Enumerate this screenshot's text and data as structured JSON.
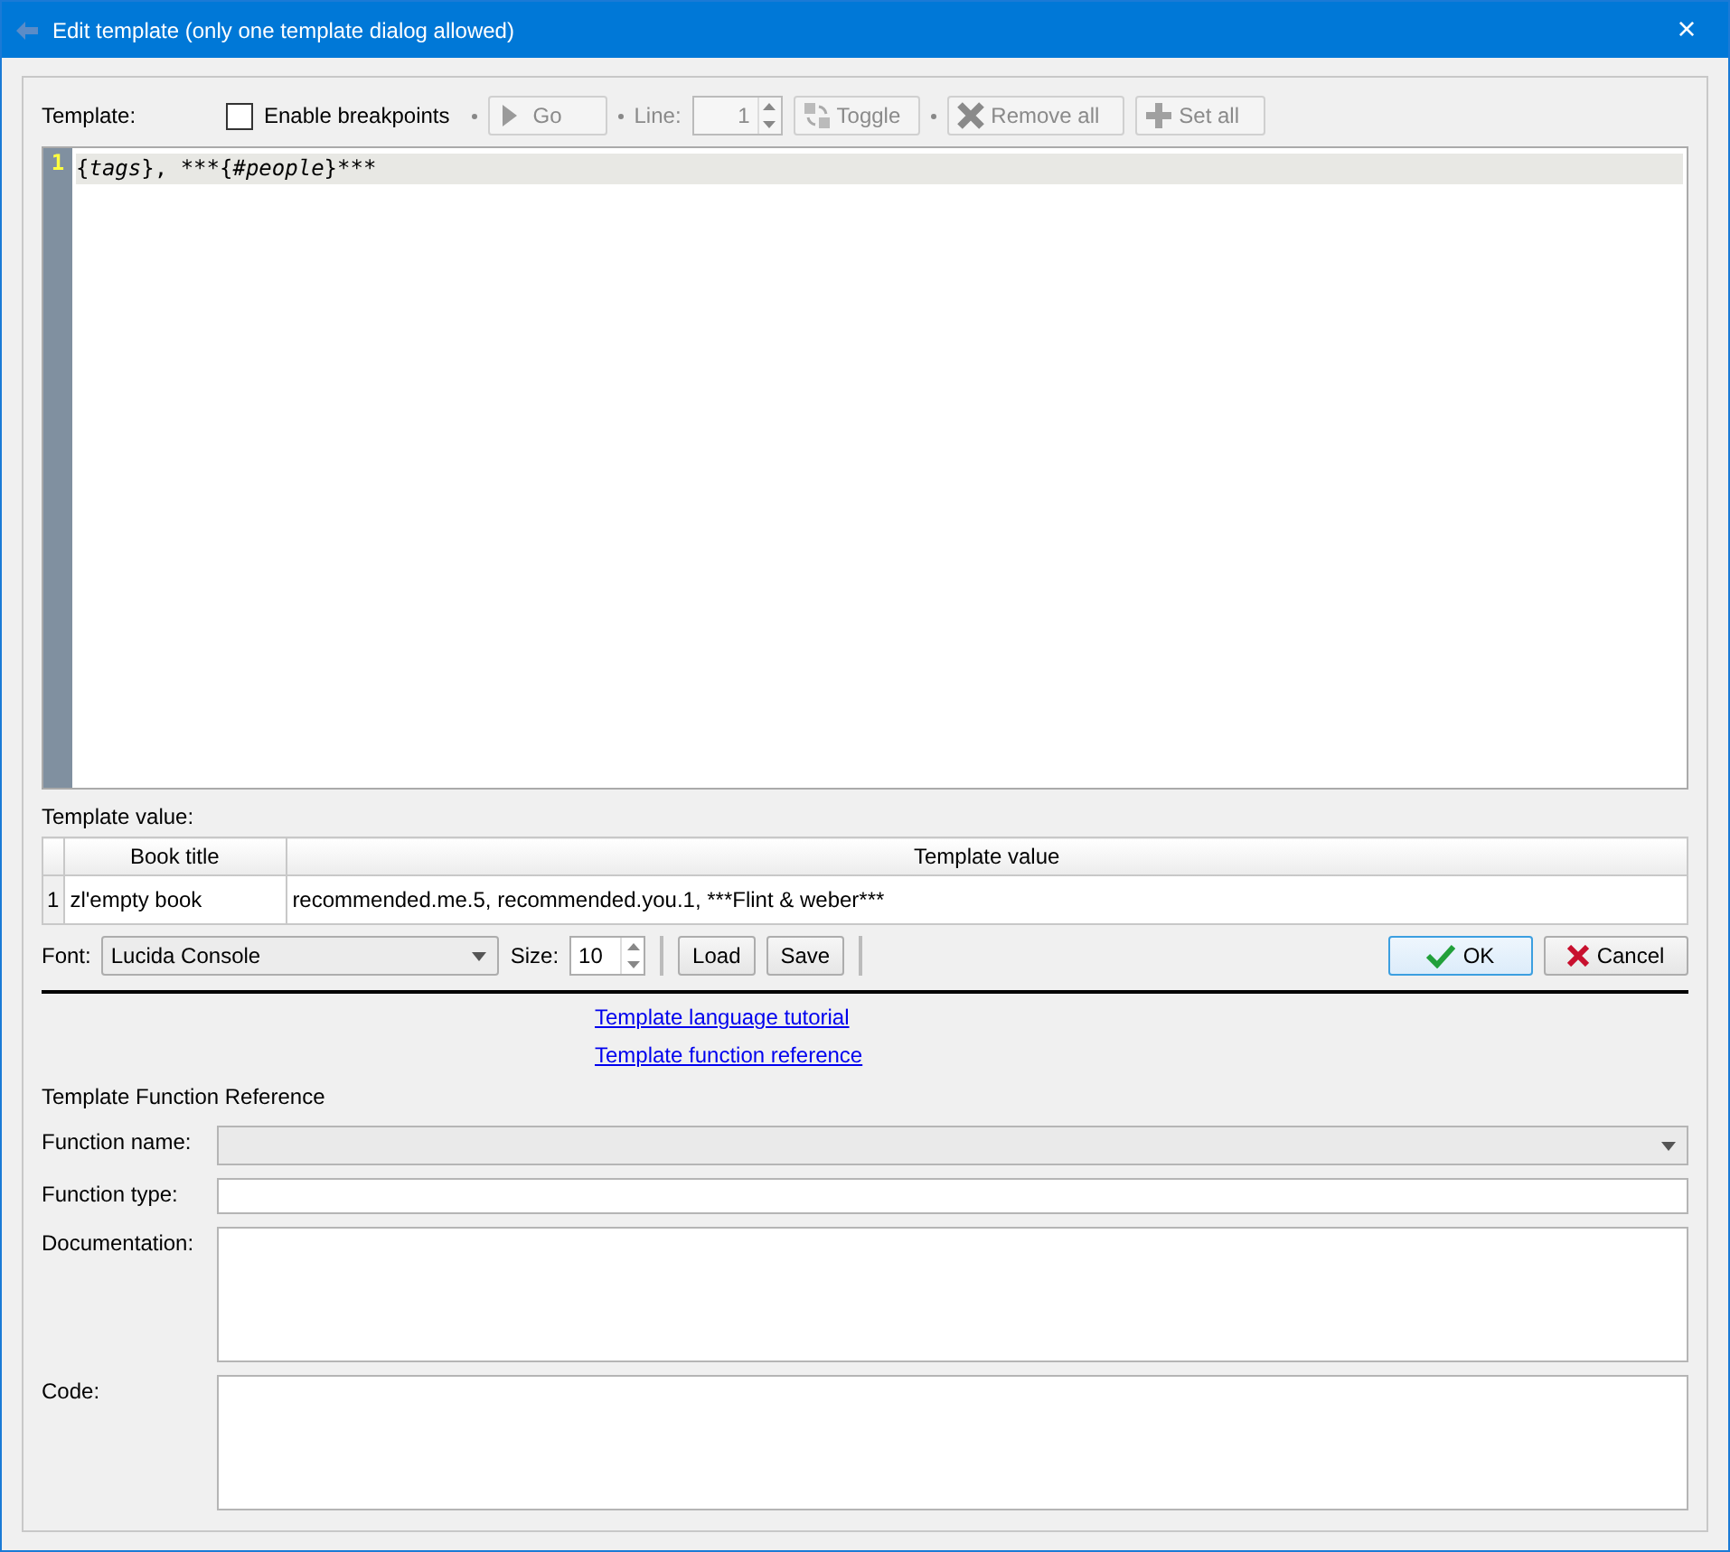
{
  "window": {
    "title": "Edit template (only one template dialog allowed)",
    "close": "×"
  },
  "toolbar": {
    "template_label": "Template:",
    "breakpoints": {
      "label": "Enable breakpoints",
      "checked": false
    },
    "items": [
      {
        "kind": "button",
        "label": "Go",
        "disabled": true
      },
      {
        "kind": "spin",
        "label": "Line:",
        "value": "1",
        "disabled": true
      },
      {
        "kind": "button",
        "label": "Toggle",
        "disabled": true
      },
      {
        "kind": "button",
        "label": "Remove all",
        "disabled": true
      },
      {
        "kind": "button",
        "label": "Set all",
        "disabled": true
      }
    ]
  },
  "editor": {
    "lines": [
      {
        "number": "1",
        "tokens": [
          {
            "text": "{",
            "italic": false
          },
          {
            "text": "tags",
            "italic": true
          },
          {
            "text": "}, ***{",
            "italic": false
          },
          {
            "text": "#people",
            "italic": true
          },
          {
            "text": "}***",
            "italic": false
          }
        ]
      }
    ]
  },
  "value_label": "Template value:",
  "table": {
    "columns": [
      "Book title",
      "Template value"
    ],
    "rows": [
      {
        "number": "1",
        "cells": [
          "zl'empty book",
          "recommended.me.5, recommended.you.1, ***Flint & weber***"
        ]
      }
    ]
  },
  "font_row": {
    "font_label": "Font:",
    "font": "Lucida Console",
    "size_label": "Size:",
    "size": "10",
    "buttons": [
      "Load",
      "Save"
    ],
    "ok": "OK",
    "cancel": "Cancel"
  },
  "links": [
    "Template language tutorial",
    "Template function reference"
  ],
  "reference": {
    "heading": "Template Function Reference",
    "fields": [
      {
        "kind": "dropdown",
        "label": "Function name:"
      },
      {
        "kind": "text",
        "label": "Function type:"
      },
      {
        "kind": "area",
        "label": "Documentation:"
      },
      {
        "kind": "area",
        "label": "Code:"
      }
    ]
  }
}
